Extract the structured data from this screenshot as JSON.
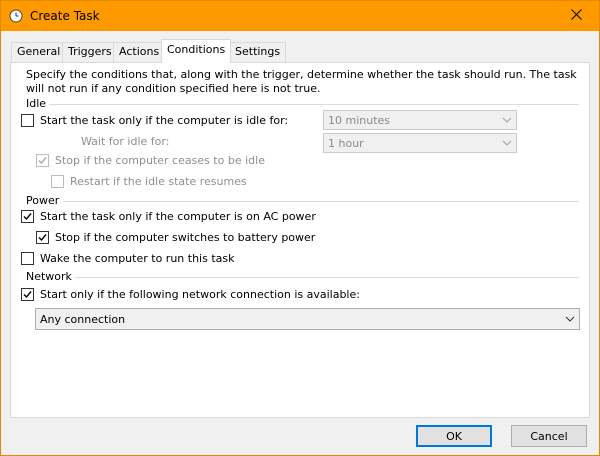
{
  "window": {
    "title": "Create Task",
    "icon": "clock-icon"
  },
  "tabs": [
    {
      "label": "General",
      "selected": false
    },
    {
      "label": "Triggers",
      "selected": false
    },
    {
      "label": "Actions",
      "selected": false
    },
    {
      "label": "Conditions",
      "selected": true
    },
    {
      "label": "Settings",
      "selected": false
    }
  ],
  "conditions": {
    "description": "Specify the conditions that, along with the trigger, determine whether the task should run.  The task will not run  if any condition specified here is not true.",
    "idle": {
      "group_label": "Idle",
      "start_if_idle": {
        "label": "Start the task only if the computer is idle for:",
        "checked": false
      },
      "idle_for_value": "10 minutes",
      "wait_label": "Wait for idle for:",
      "wait_value": "1 hour",
      "stop_if_ceases": {
        "label": "Stop if the computer ceases to be idle",
        "checked": true,
        "disabled": true
      },
      "restart_if_resumes": {
        "label": "Restart if the idle state resumes",
        "checked": false,
        "disabled": true
      }
    },
    "power": {
      "group_label": "Power",
      "ac_power": {
        "label": "Start the task only if the computer is on AC power",
        "checked": true
      },
      "battery_stop": {
        "label": "Stop if the computer switches to battery power",
        "checked": true
      },
      "wake": {
        "label": "Wake the computer to run this task",
        "checked": false
      }
    },
    "network": {
      "group_label": "Network",
      "start_only_if": {
        "label": "Start only if the following network connection is available:",
        "checked": true
      },
      "connection_value": "Any connection"
    }
  },
  "buttons": {
    "ok": "OK",
    "cancel": "Cancel"
  },
  "colors": {
    "titlebar": "#ff9900",
    "default_button_border": "#0078d7"
  }
}
